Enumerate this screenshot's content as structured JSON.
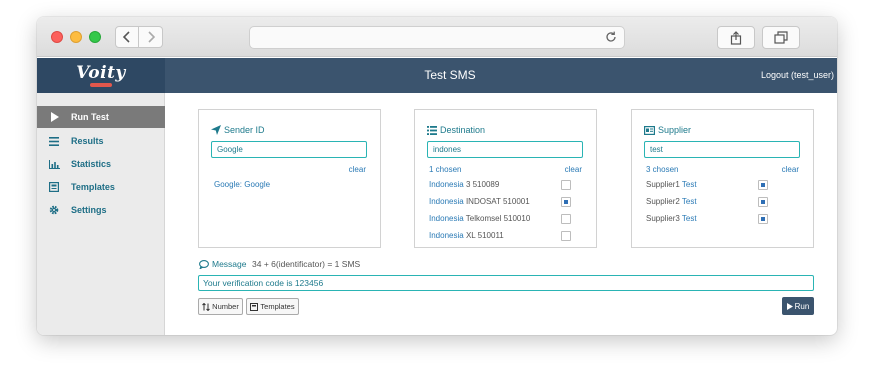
{
  "app": {
    "logo_text": "Voity",
    "page_title": "Test SMS",
    "logout_label": "Logout (test_user)",
    "colors": {
      "header": "#3b546e",
      "brand": "#2e4863",
      "accent": "#2ab4b4",
      "link": "#2a7ab5"
    }
  },
  "browser": {
    "back_icon": "chevron-left-icon",
    "forward_icon": "chevron-right-icon",
    "reload_icon": "reload-icon",
    "share_icon": "share-icon",
    "tabs_icon": "tabs-icon"
  },
  "sidebar": {
    "items": [
      {
        "label": "Run Test",
        "icon": "play-icon",
        "active": true
      },
      {
        "label": "Results",
        "icon": "list-icon",
        "active": false
      },
      {
        "label": "Statistics",
        "icon": "bar-chart-icon",
        "active": false
      },
      {
        "label": "Templates",
        "icon": "template-icon",
        "active": false
      },
      {
        "label": "Settings",
        "icon": "gear-icon",
        "active": false
      }
    ]
  },
  "sender": {
    "title": "Sender ID",
    "input_value": "Google",
    "clear_label": "clear",
    "chosen_prefix": "Google:",
    "chosen_value": "Google"
  },
  "destination": {
    "title": "Destination",
    "input_value": "indones",
    "chosen_label": "1 chosen",
    "clear_label": "clear",
    "rows": [
      {
        "country": "Indonesia",
        "detail": "3 510089",
        "checked": false
      },
      {
        "country": "Indonesia",
        "detail": "INDOSAT 510001",
        "checked": true
      },
      {
        "country": "Indonesia",
        "detail": "Telkomsel 510010",
        "checked": false
      },
      {
        "country": "Indonesia",
        "detail": "XL 510011",
        "checked": false
      }
    ]
  },
  "supplier": {
    "title": "Supplier",
    "input_value": "test",
    "chosen_label": "3 chosen",
    "clear_label": "clear",
    "rows": [
      {
        "name": "Supplier1",
        "tag": "Test",
        "checked": true
      },
      {
        "name": "Supplier2",
        "tag": "Test",
        "checked": true
      },
      {
        "name": "Supplier3",
        "tag": "Test",
        "checked": true
      }
    ]
  },
  "message": {
    "label": "Message",
    "info": "34 + 6(identificator) = 1 SMS",
    "value": "Your  verification code  is 123456",
    "number_btn": "Number",
    "templates_btn": "Templates",
    "run_btn": "Run"
  }
}
